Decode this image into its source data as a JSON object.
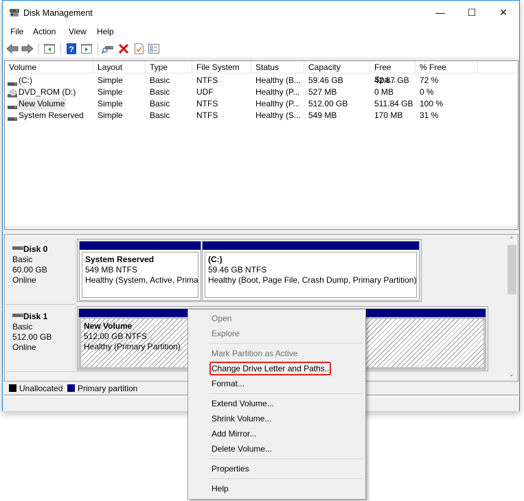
{
  "window": {
    "title": "Disk Management",
    "minimize": "—",
    "maximize": "☐",
    "close": "✕"
  },
  "menubar": [
    "File",
    "Action",
    "View",
    "Help"
  ],
  "toolbar": [
    "back-icon",
    "forward-icon",
    "show-hide-console-tree-icon",
    "help-icon",
    "show-hide-action-pane-icon",
    "connect-drive-icon",
    "delete-icon",
    "checklist-icon",
    "properties-icon"
  ],
  "volumes": {
    "columns": [
      "Volume",
      "Layout",
      "Type",
      "File System",
      "Status",
      "Capacity",
      "Free Spa...",
      "% Free"
    ],
    "rows": [
      {
        "icon": "drive-icon",
        "volume": " (C:)",
        "layout": "Simple",
        "type": "Basic",
        "fs": "NTFS",
        "status": "Healthy (B...",
        "capacity": "59.46 GB",
        "free": "42.87 GB",
        "pct": "72 %"
      },
      {
        "icon": "dvd-icon",
        "volume": "DVD_ROM (D:)",
        "layout": "Simple",
        "type": "Basic",
        "fs": "UDF",
        "status": "Healthy (P...",
        "capacity": "527 MB",
        "free": "0 MB",
        "pct": "0 %"
      },
      {
        "icon": "drive-icon",
        "volume": "New Volume",
        "layout": "Simple",
        "type": "Basic",
        "fs": "NTFS",
        "status": "Healthy (P...",
        "capacity": "512.00 GB",
        "free": "511.84 GB",
        "pct": "100 %",
        "selected": true
      },
      {
        "icon": "drive-icon",
        "volume": "System Reserved",
        "layout": "Simple",
        "type": "Basic",
        "fs": "NTFS",
        "status": "Healthy (S...",
        "capacity": "549 MB",
        "free": "170 MB",
        "pct": "31 %"
      }
    ]
  },
  "disks": [
    {
      "name": "Disk 0",
      "type": "Basic",
      "size": "60.00 GB",
      "state": "Online",
      "partitions": [
        {
          "name": "System Reserved",
          "size": "549 MB NTFS",
          "status": "Healthy (System, Active, Primary Partition)"
        },
        {
          "name": " (C:)",
          "size": "59.46 GB NTFS",
          "status": "Healthy (Boot, Page File, Crash Dump, Primary Partition)"
        }
      ]
    },
    {
      "name": "Disk 1",
      "type": "Basic",
      "size": "512.00 GB",
      "state": "Online",
      "partitions": [
        {
          "name": "New Volume",
          "size": "512.00 GB NTFS",
          "status": "Healthy (Primary Partition)"
        }
      ]
    }
  ],
  "legend": [
    {
      "label": "Unallocated",
      "color": "#000000"
    },
    {
      "label": "Primary partition",
      "color": "#000080"
    }
  ],
  "context_menu": {
    "items": [
      {
        "label": "Open",
        "disabled": true
      },
      {
        "label": "Explore",
        "disabled": true
      },
      {
        "label": "Mark Partition as Active",
        "disabled": true
      },
      {
        "label": "Change Drive Letter and Paths...",
        "highlighted": true
      },
      {
        "label": "Format..."
      },
      {
        "label": "Extend Volume..."
      },
      {
        "label": "Shrink Volume..."
      },
      {
        "label": "Add Mirror..."
      },
      {
        "label": "Delete Volume..."
      },
      {
        "label": "Properties"
      },
      {
        "label": "Help"
      }
    ],
    "highlight_color": "#e8201b"
  }
}
